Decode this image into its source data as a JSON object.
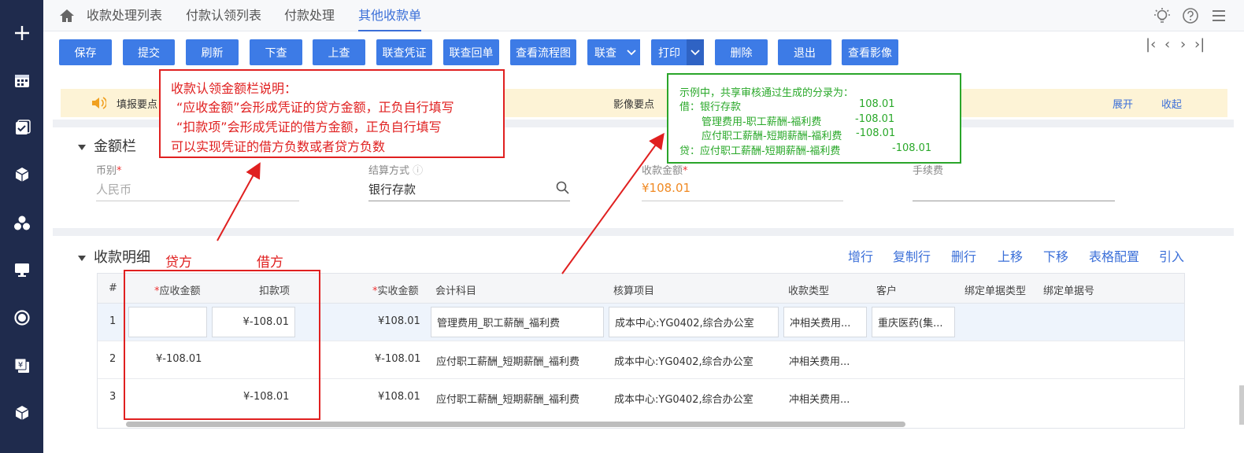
{
  "tabs": [
    "收款处理列表",
    "付款认领列表",
    "付款处理",
    "其他收款单"
  ],
  "toolbar": {
    "buttons": [
      "保存",
      "提交",
      "刷新",
      "下查",
      "上查",
      "联查凭证",
      "联查回单",
      "查看流程图",
      "联查",
      "打印",
      "删除",
      "退出",
      "查看影像"
    ]
  },
  "notice": {
    "left": "填报要点",
    "center": "影像要点",
    "expand": "展开",
    "collapse": "收起"
  },
  "amount_section": {
    "title": "金额栏",
    "currency_label": "币别",
    "currency_value": "人民币",
    "settle_label": "结算方式",
    "settle_value": "银行存款",
    "amount_label": "收款金额",
    "amount_value": "¥108.01",
    "fee_label": "手续费"
  },
  "detail_section": {
    "title": "收款明细",
    "actions": [
      "增行",
      "复制行",
      "删行",
      "上移",
      "下移",
      "表格配置",
      "引入"
    ],
    "columns": {
      "index": "#",
      "receivable": "应收金额",
      "deduction": "扣款项",
      "received": "实收金额",
      "account": "会计科目",
      "item": "核算项目",
      "type": "收款类型",
      "customer": "客户",
      "bind_type": "绑定单据类型",
      "bind_no": "绑定单据号"
    },
    "rows": [
      {
        "no": "1",
        "receivable": "",
        "deduction": "¥-108.01",
        "received": "¥108.01",
        "account": "管理费用_职工薪酬_福利费",
        "item": "成本中心:YG0402,综合办公室",
        "type": "冲相关费用...",
        "customer": "重庆医药(集..."
      },
      {
        "no": "2",
        "receivable": "¥-108.01",
        "deduction": "",
        "received": "¥-108.01",
        "account": "应付职工薪酬_短期薪酬_福利费",
        "item": "成本中心:YG0402,综合办公室",
        "type": "冲相关费用...",
        "customer": ""
      },
      {
        "no": "3",
        "receivable": "",
        "deduction": "¥-108.01",
        "received": "¥108.01",
        "account": "应付职工薪酬_短期薪酬_福利费",
        "item": "成本中心:YG0402,综合办公室",
        "type": "冲相关费用...",
        "customer": ""
      }
    ]
  },
  "annotation_red": {
    "lines": [
      "收款认领金额栏说明：",
      "“应收金额”会形成凭证的贷方金额，正负自行填写",
      "“扣款项”会形成凭证的借方金额，正负自行填写",
      "可以实现凭证的借方负数或者贷方负数"
    ],
    "credit_label": "贷方",
    "debit_label": "借方"
  },
  "annotation_green": {
    "lines": [
      {
        "text": "示例中，共享审核通过生成的分录为：",
        "amount": ""
      },
      {
        "text": "借：银行存款",
        "amount": "108.01"
      },
      {
        "text": "管理费用-职工薪酬-福利费",
        "amount": "-108.01"
      },
      {
        "text": "应付职工薪酬-短期薪酬-福利费",
        "amount": "-108.01"
      },
      {
        "text": "贷：应付职工薪酬-短期薪酬-福利费",
        "amount": "-108.01"
      }
    ]
  },
  "colors": {
    "sidebar": "#1f2b4d",
    "primary": "#3d7be6",
    "annotation_red": "#e02020",
    "annotation_green": "#29a829",
    "amount_orange": "#f08a24"
  }
}
